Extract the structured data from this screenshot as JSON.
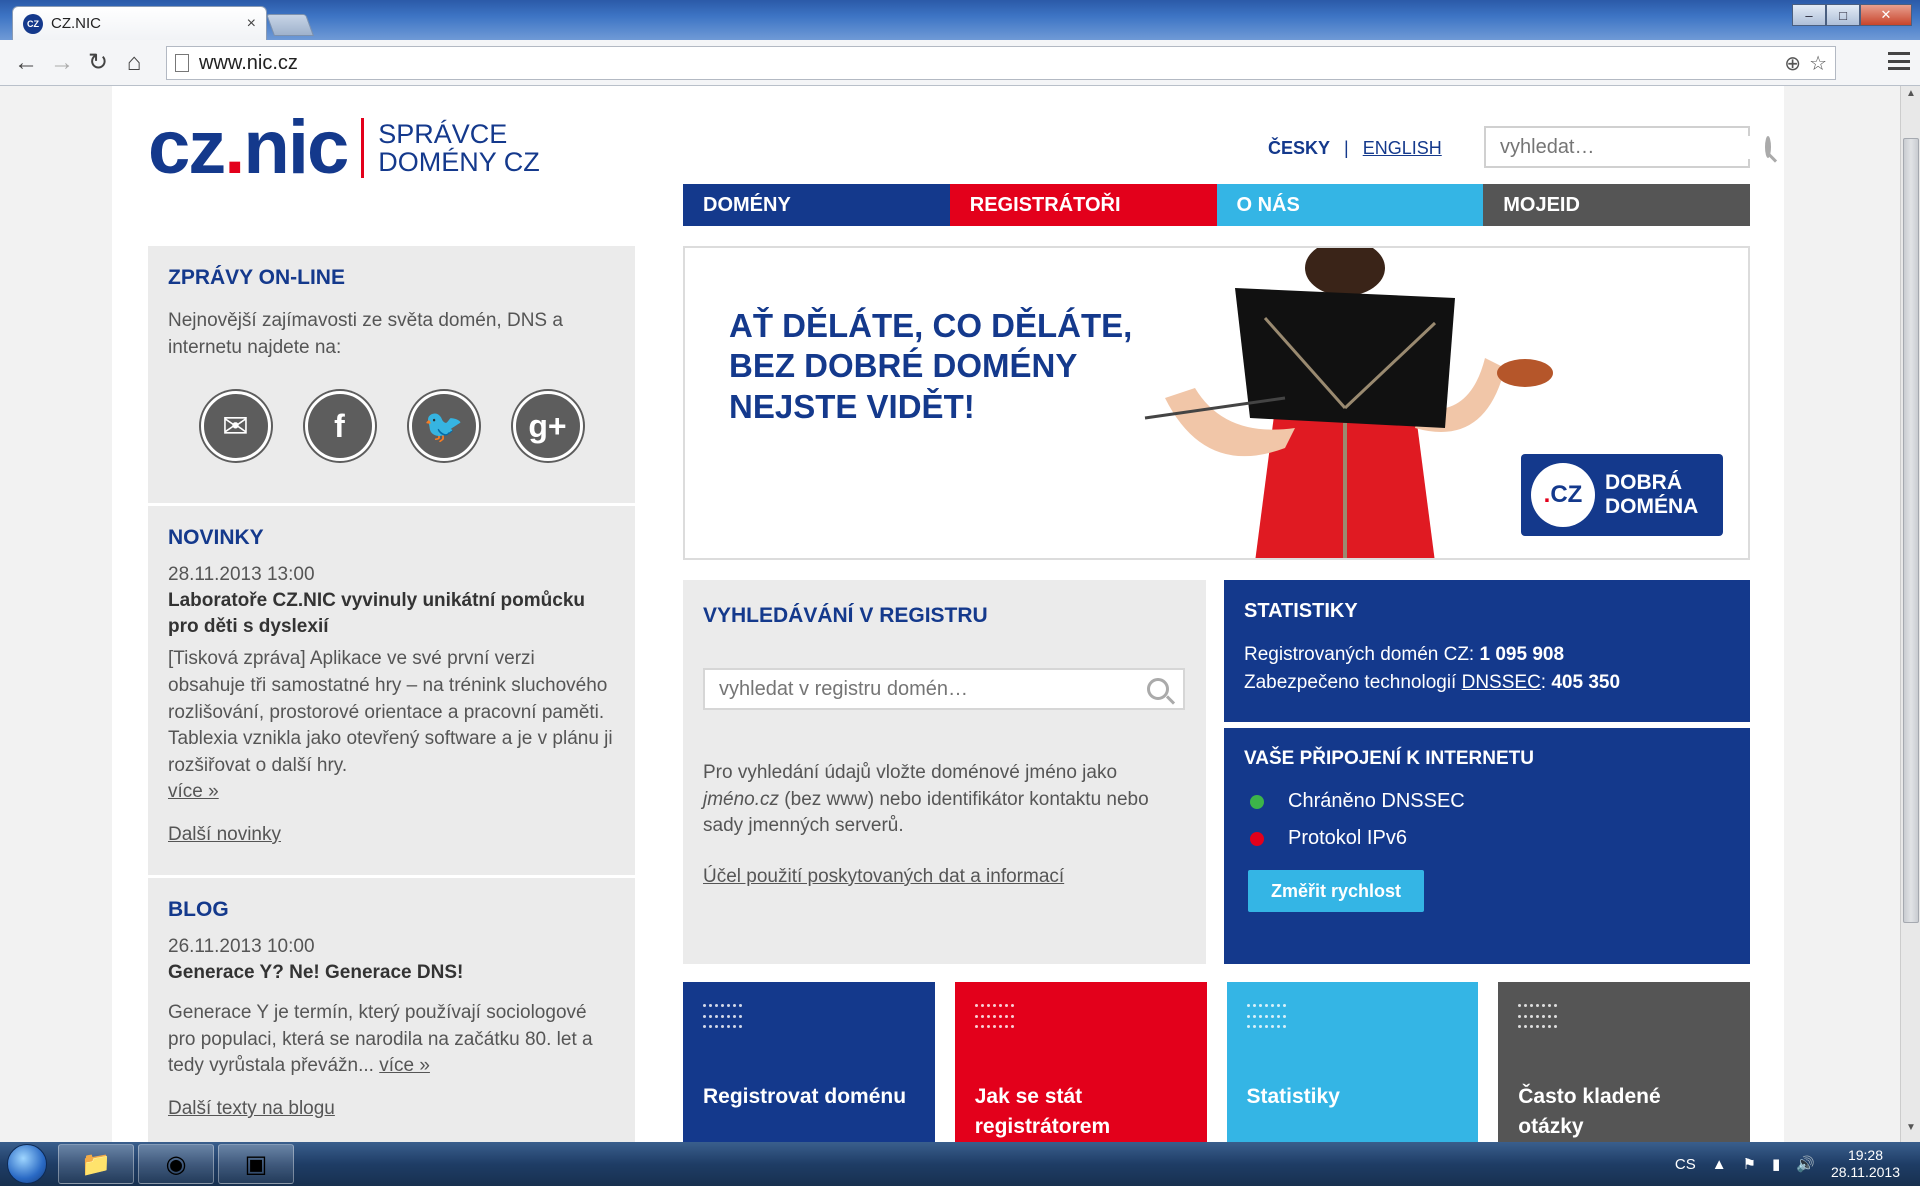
{
  "browser": {
    "tab_title": "CZ.NIC",
    "tab_favicon": "CZ",
    "tab_close": "×",
    "url": "www.nic.cz",
    "win_min": "–",
    "win_max": "□",
    "win_close": "✕"
  },
  "header": {
    "logo_left": "cz",
    "logo_dot": ".",
    "logo_right": "nic",
    "logo_sub_1": "SPRÁVCE",
    "logo_sub_2": "DOMÉNY CZ",
    "lang_cs": "ČESKY",
    "lang_separator": "|",
    "lang_en": "ENGLISH",
    "search_placeholder": "vyhledat…"
  },
  "nav": {
    "domeny": "DOMÉNY",
    "registratori": "REGISTRÁTOŘI",
    "onas": "O NÁS",
    "mojeid": "MOJEID"
  },
  "online": {
    "title": "ZPRÁVY ON-LINE",
    "text": "Nejnovější zajímavosti ze světa domén, DNS a internetu najdete na:"
  },
  "news": {
    "title": "NOVINKY",
    "date": "28.11.2013 13:00",
    "headline": "Laboratoře CZ.NIC vyvinuly unikátní pomůcku pro děti s dyslexií",
    "body": "[Tisková zpráva] Aplikace ve své první verzi obsahuje tři samostatné hry – na trénink sluchového rozlišování, prostorové orientace a pracovní paměti. Tablexia vznikla jako otevřený software a je v plánu ji rozšiřovat o další hry.",
    "more": "více »",
    "all": "Další novinky"
  },
  "blog": {
    "title": "BLOG",
    "date": "26.11.2013 10:00",
    "headline": "Generace Y? Ne! Generace DNS!",
    "body": "Generace Y je termín, který používají sociologové pro populaci, která se narodila na začátku 80. let a tedy vyrůstala převážn...",
    "more": "více »",
    "all": "Další texty na blogu"
  },
  "banner": {
    "line1": "AŤ DĚLÁTE, CO DĚLÁTE,",
    "line2": "BEZ DOBRÉ DOMÉNY",
    "line3": "NEJSTE VIDĚT!",
    "badge_dot": ".",
    "badge_logo": "CZ",
    "badge_line1": "DOBRÁ",
    "badge_line2": "DOMÉNA"
  },
  "registry": {
    "title": "VYHLEDÁVÁNÍ V REGISTRU",
    "placeholder": "vyhledat v registru domén…",
    "text_before": "Pro vyhledání údajů vložte doménové jméno jako ",
    "text_italic": "jméno.cz",
    "text_after": " (bez www) nebo identifikátor kontaktu nebo sady jmenných serverů.",
    "link": "Účel použití poskytovaných dat a informací"
  },
  "stats": {
    "title": "STATISTIKY",
    "registered_label": "Registrovaných domén CZ: ",
    "registered_value": "1 095 908",
    "secured_label": "Zabezpečeno technologií ",
    "secured_link": "DNSSEC",
    "secured_colon": ": ",
    "secured_value": "405 350"
  },
  "connection": {
    "title": "VAŠE PŘIPOJENÍ K INTERNETU",
    "item1": "Chráněno DNSSEC",
    "item2": "Protokol IPv6",
    "button": "Změřit rychlost"
  },
  "tiles": {
    "t1": "Registrovat doménu",
    "t2": "Jak se stát registrátorem",
    "t3": "Statistiky",
    "t4": "Často kladené otázky"
  },
  "taskbar": {
    "lang": "CS",
    "time": "19:28",
    "date": "28.11.2013"
  },
  "colors": {
    "brand_blue": "#14398c",
    "brand_red": "#e3001b",
    "brand_cyan": "#34b5e5",
    "brand_gray": "#555555"
  }
}
